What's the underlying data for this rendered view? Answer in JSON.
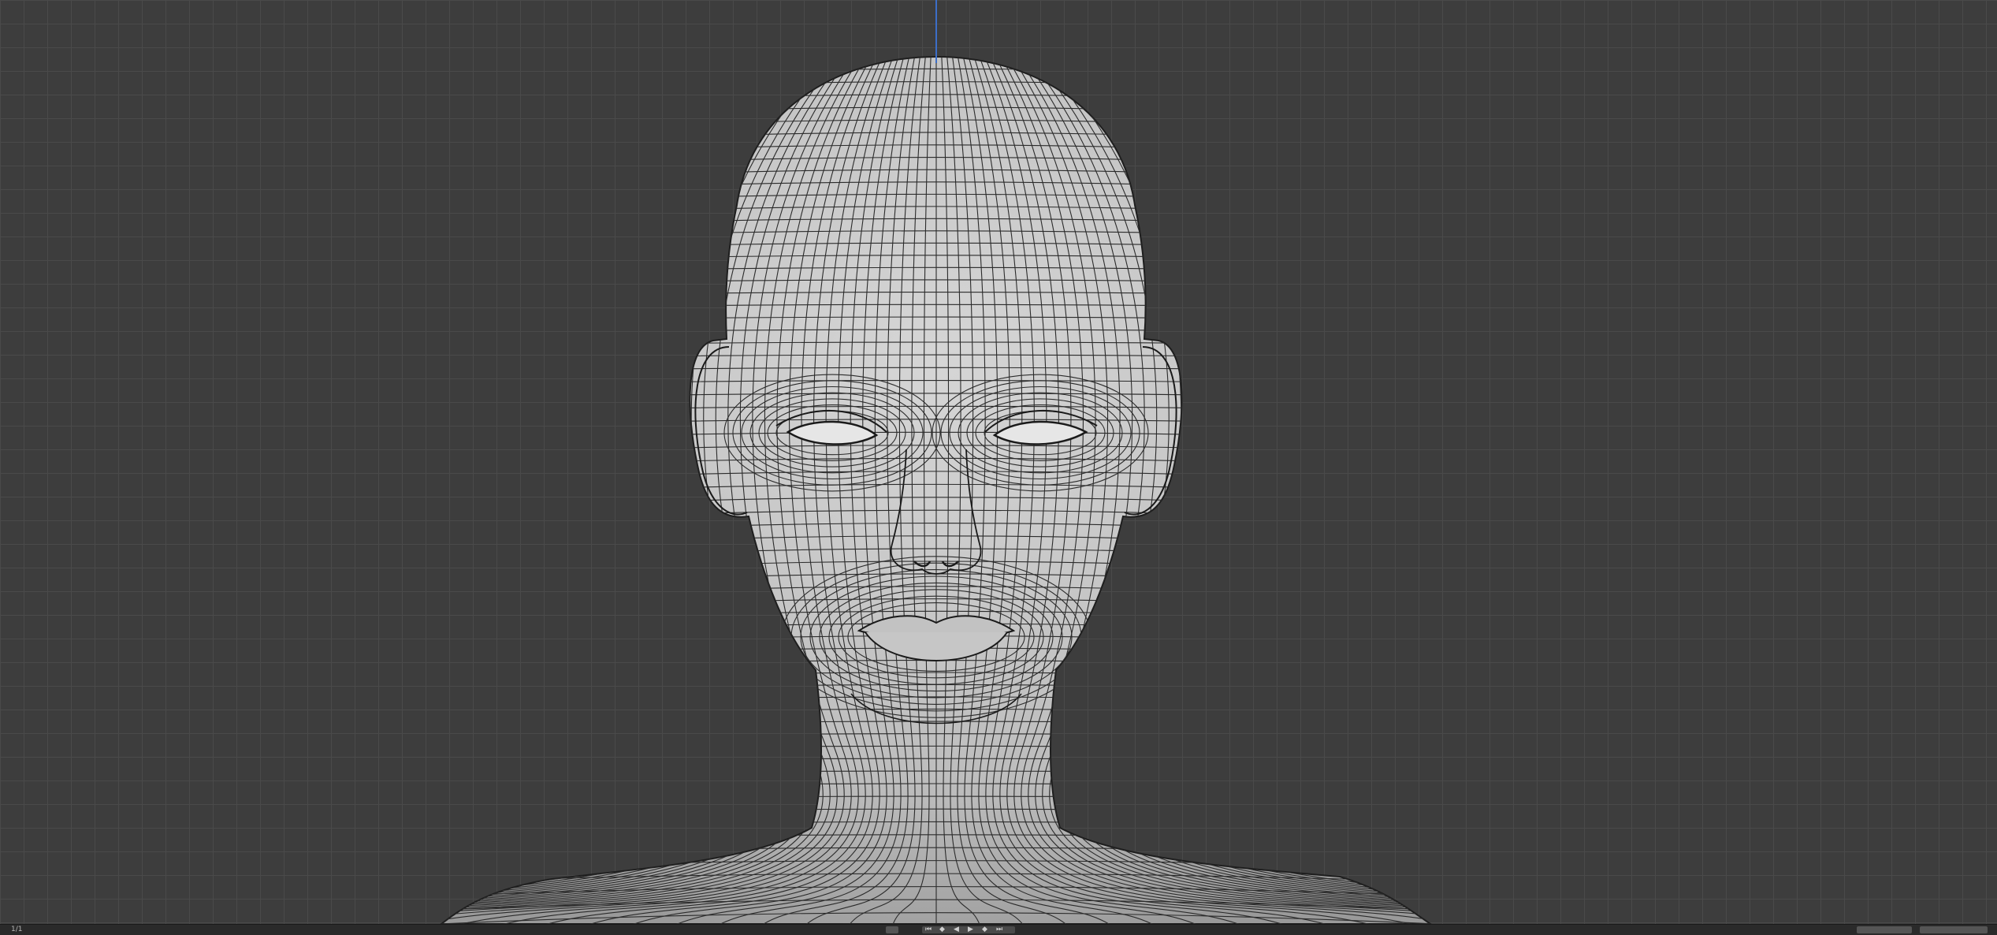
{
  "viewport": {
    "background": "#3d3d3d",
    "grid_color": "#4a4a4a",
    "axis_color": "#3c6ec8"
  },
  "model": {
    "fill": "#c9c9c9",
    "wire": "#2b2b2b"
  },
  "timeline": {
    "corner_label": "1/1",
    "controls": [
      "jump-start",
      "prev-key",
      "play-reverse",
      "play",
      "next-key",
      "jump-end"
    ],
    "right_buttons": [
      "",
      ""
    ]
  }
}
